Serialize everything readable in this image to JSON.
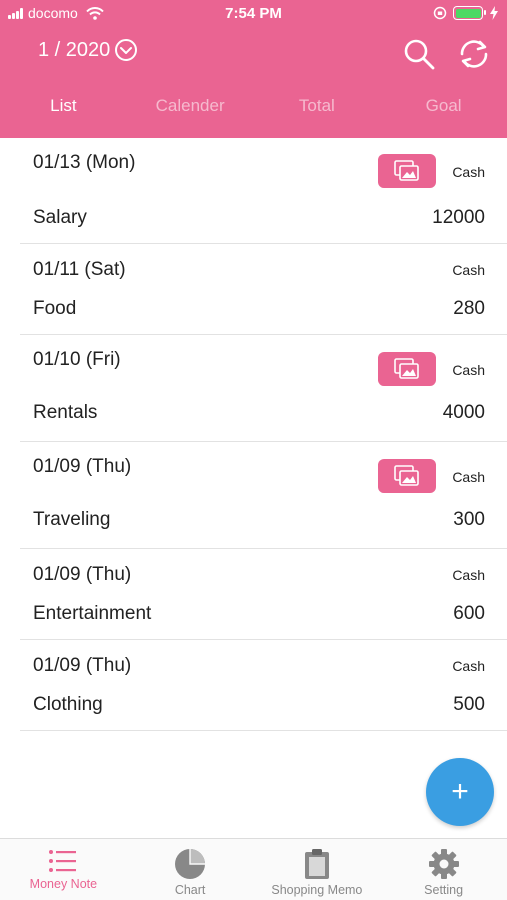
{
  "status_bar": {
    "carrier": "docomo",
    "time": "7:54 PM"
  },
  "header": {
    "month": "1 / 2020"
  },
  "tabs": [
    {
      "label": "List",
      "active": true
    },
    {
      "label": "Calender",
      "active": false
    },
    {
      "label": "Total",
      "active": false
    },
    {
      "label": "Goal",
      "active": false
    }
  ],
  "entries": [
    {
      "date": "01/13 (Mon)",
      "category": "Salary",
      "amount": "12000",
      "payment": "Cash",
      "has_photo": true
    },
    {
      "date": "01/11 (Sat)",
      "category": "Food",
      "amount": "280",
      "payment": "Cash",
      "has_photo": false
    },
    {
      "date": "01/10 (Fri)",
      "category": "Rentals",
      "amount": "4000",
      "payment": "Cash",
      "has_photo": true
    },
    {
      "date": "01/09 (Thu)",
      "category": "Traveling",
      "amount": "300",
      "payment": "Cash",
      "has_photo": true
    },
    {
      "date": "01/09 (Thu)",
      "category": "Entertainment",
      "amount": "600",
      "payment": "Cash",
      "has_photo": false
    },
    {
      "date": "01/09 (Thu)",
      "category": "Clothing",
      "amount": "500",
      "payment": "Cash",
      "has_photo": false
    }
  ],
  "fab": {
    "label": "+"
  },
  "bottom_nav": [
    {
      "label": "Money Note",
      "icon": "list-icon",
      "active": true
    },
    {
      "label": "Chart",
      "icon": "pie-chart-icon",
      "active": false
    },
    {
      "label": "Shopping Memo",
      "icon": "clipboard-icon",
      "active": false
    },
    {
      "label": "Setting",
      "icon": "gear-icon",
      "active": false
    }
  ],
  "colors": {
    "brand": "#ea6492",
    "fab": "#3a9ee2",
    "battery": "#4cd964"
  }
}
